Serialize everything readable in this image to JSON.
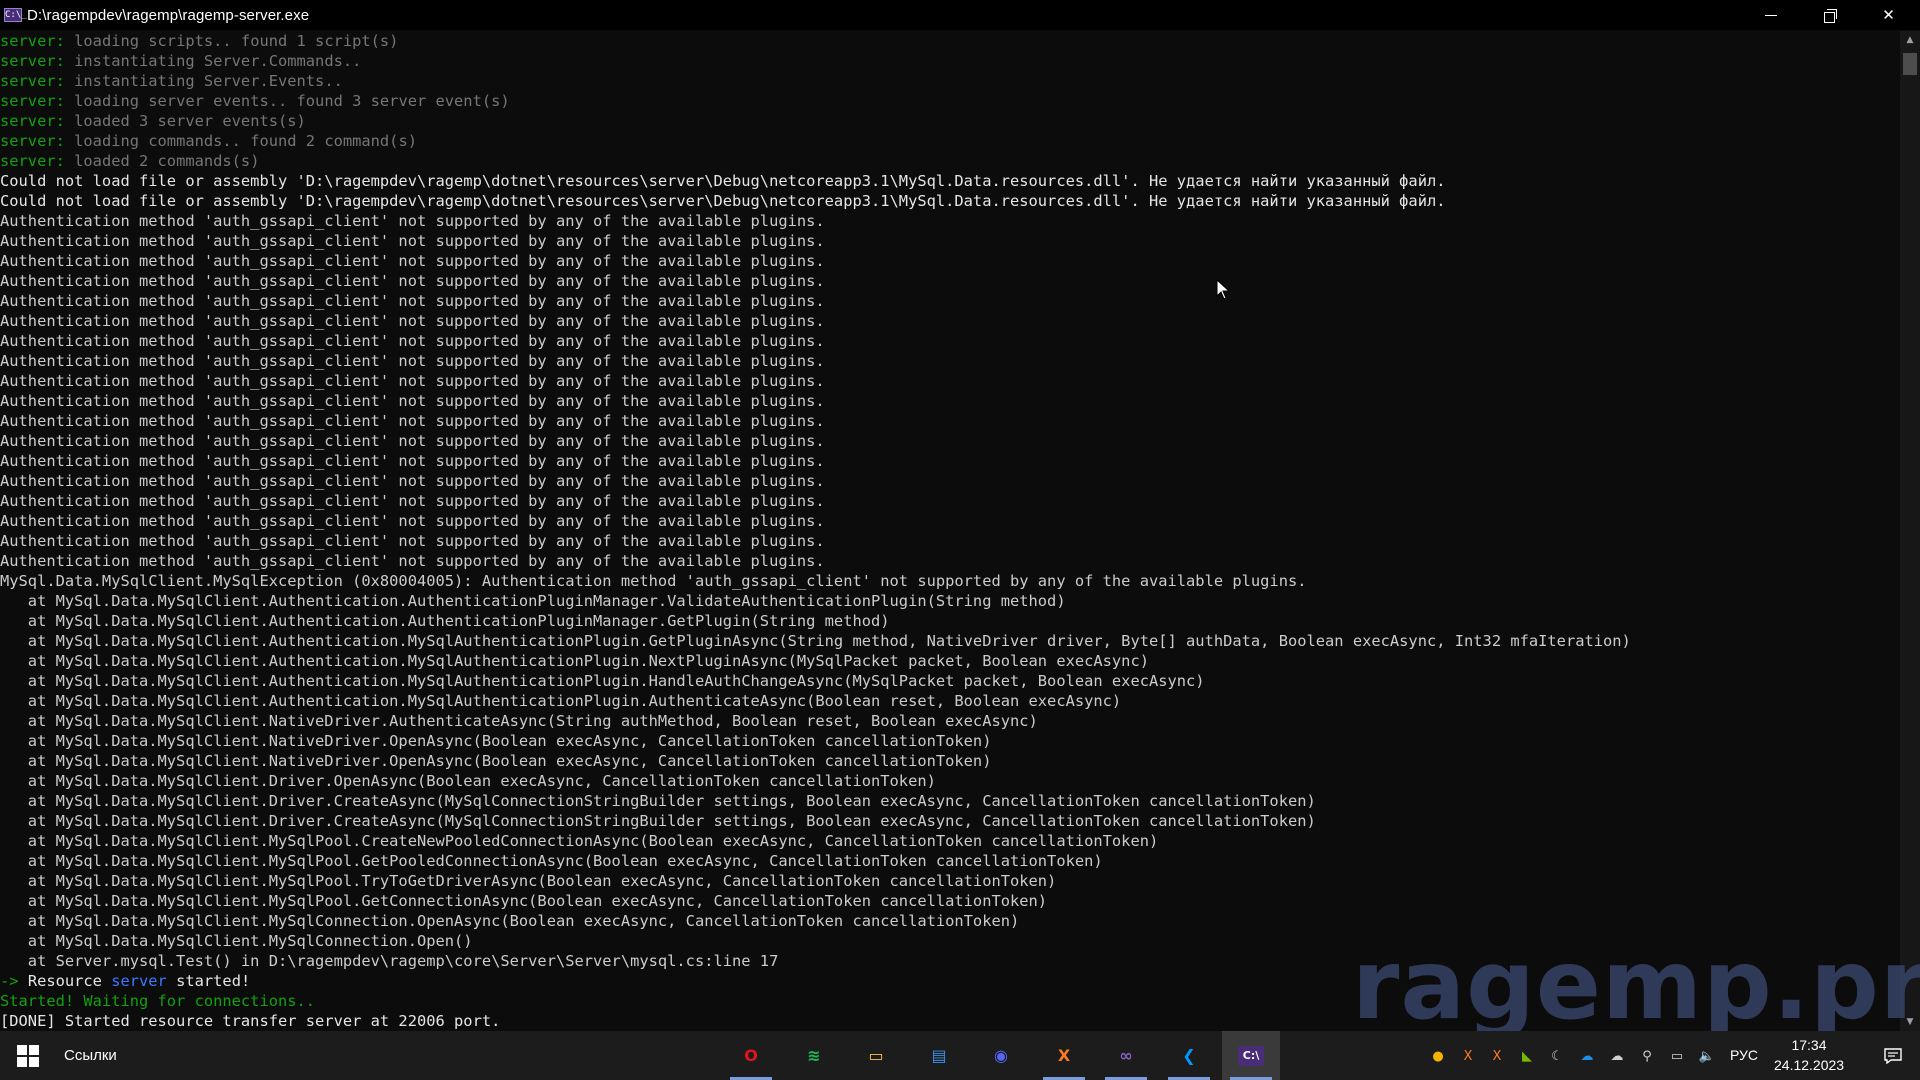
{
  "window": {
    "title": "D:\\ragempdev\\ragemp\\ragemp-server.exe",
    "app_icon_glyph": "C:\\_"
  },
  "colors": {
    "console_bg": "#0c0c0c",
    "default_text": "#cccccc",
    "prefix_green": "#13a10e",
    "dim_gray": "#767676",
    "accent_blue": "#3b78ff",
    "watermark": "#3a466e"
  },
  "console": {
    "lines": [
      {
        "prefix": "server:",
        "pc": "c-green",
        "text": " loading scripts.. found 1 script(s)",
        "tc": "c-gray"
      },
      {
        "prefix": "server:",
        "pc": "c-green",
        "text": " instantiating Server.Commands..",
        "tc": "c-gray"
      },
      {
        "prefix": "server:",
        "pc": "c-green",
        "text": " instantiating Server.Events..",
        "tc": "c-gray"
      },
      {
        "prefix": "server:",
        "pc": "c-green",
        "text": " loading server events.. found 3 server event(s)",
        "tc": "c-gray"
      },
      {
        "prefix": "server:",
        "pc": "c-green",
        "text": " loaded 3 server events(s)",
        "tc": "c-gray"
      },
      {
        "prefix": "server:",
        "pc": "c-green",
        "text": " loading commands.. found 2 command(s)",
        "tc": "c-gray"
      },
      {
        "prefix": "server:",
        "pc": "c-green",
        "text": " loaded 2 commands(s)",
        "tc": "c-gray"
      },
      {
        "text": "Could not load file or assembly 'D:\\ragempdev\\ragemp\\dotnet\\resources\\server\\Debug\\netcoreapp3.1\\MySql.Data.resources.dll'. Не удается найти указанный файл.",
        "tc": "c-white"
      },
      {
        "text": "Could not load file or assembly 'D:\\ragempdev\\ragemp\\dotnet\\resources\\server\\Debug\\netcoreapp3.1\\MySql.Data.resources.dll'. Не удается найти указанный файл.",
        "tc": "c-white"
      },
      {
        "text": "Authentication method 'auth_gssapi_client' not supported by any of the available plugins.",
        "tc": "c-light"
      },
      {
        "text": "Authentication method 'auth_gssapi_client' not supported by any of the available plugins.",
        "tc": "c-light"
      },
      {
        "text": "Authentication method 'auth_gssapi_client' not supported by any of the available plugins.",
        "tc": "c-light"
      },
      {
        "text": "Authentication method 'auth_gssapi_client' not supported by any of the available plugins.",
        "tc": "c-light"
      },
      {
        "text": "Authentication method 'auth_gssapi_client' not supported by any of the available plugins.",
        "tc": "c-light"
      },
      {
        "text": "Authentication method 'auth_gssapi_client' not supported by any of the available plugins.",
        "tc": "c-light"
      },
      {
        "text": "Authentication method 'auth_gssapi_client' not supported by any of the available plugins.",
        "tc": "c-light"
      },
      {
        "text": "Authentication method 'auth_gssapi_client' not supported by any of the available plugins.",
        "tc": "c-light"
      },
      {
        "text": "Authentication method 'auth_gssapi_client' not supported by any of the available plugins.",
        "tc": "c-light"
      },
      {
        "text": "Authentication method 'auth_gssapi_client' not supported by any of the available plugins.",
        "tc": "c-light"
      },
      {
        "text": "Authentication method 'auth_gssapi_client' not supported by any of the available plugins.",
        "tc": "c-light"
      },
      {
        "text": "Authentication method 'auth_gssapi_client' not supported by any of the available plugins.",
        "tc": "c-light"
      },
      {
        "text": "Authentication method 'auth_gssapi_client' not supported by any of the available plugins.",
        "tc": "c-light"
      },
      {
        "text": "Authentication method 'auth_gssapi_client' not supported by any of the available plugins.",
        "tc": "c-light"
      },
      {
        "text": "Authentication method 'auth_gssapi_client' not supported by any of the available plugins.",
        "tc": "c-light"
      },
      {
        "text": "Authentication method 'auth_gssapi_client' not supported by any of the available plugins.",
        "tc": "c-light"
      },
      {
        "text": "Authentication method 'auth_gssapi_client' not supported by any of the available plugins.",
        "tc": "c-light"
      },
      {
        "text": "Authentication method 'auth_gssapi_client' not supported by any of the available plugins.",
        "tc": "c-light"
      },
      {
        "text": "MySql.Data.MySqlClient.MySqlException (0x80004005): Authentication method 'auth_gssapi_client' not supported by any of the available plugins.",
        "tc": "c-light"
      },
      {
        "text": "   at MySql.Data.MySqlClient.Authentication.AuthenticationPluginManager.ValidateAuthenticationPlugin(String method)",
        "tc": "c-light"
      },
      {
        "text": "   at MySql.Data.MySqlClient.Authentication.AuthenticationPluginManager.GetPlugin(String method)",
        "tc": "c-light"
      },
      {
        "text": "   at MySql.Data.MySqlClient.Authentication.MySqlAuthenticationPlugin.GetPluginAsync(String method, NativeDriver driver, Byte[] authData, Boolean execAsync, Int32 mfaIteration)",
        "tc": "c-light"
      },
      {
        "text": "   at MySql.Data.MySqlClient.Authentication.MySqlAuthenticationPlugin.NextPluginAsync(MySqlPacket packet, Boolean execAsync)",
        "tc": "c-light"
      },
      {
        "text": "   at MySql.Data.MySqlClient.Authentication.MySqlAuthenticationPlugin.HandleAuthChangeAsync(MySqlPacket packet, Boolean execAsync)",
        "tc": "c-light"
      },
      {
        "text": "   at MySql.Data.MySqlClient.Authentication.MySqlAuthenticationPlugin.AuthenticateAsync(Boolean reset, Boolean execAsync)",
        "tc": "c-light"
      },
      {
        "text": "   at MySql.Data.MySqlClient.NativeDriver.AuthenticateAsync(String authMethod, Boolean reset, Boolean execAsync)",
        "tc": "c-light"
      },
      {
        "text": "   at MySql.Data.MySqlClient.NativeDriver.OpenAsync(Boolean execAsync, CancellationToken cancellationToken)",
        "tc": "c-light"
      },
      {
        "text": "   at MySql.Data.MySqlClient.NativeDriver.OpenAsync(Boolean execAsync, CancellationToken cancellationToken)",
        "tc": "c-light"
      },
      {
        "text": "   at MySql.Data.MySqlClient.Driver.OpenAsync(Boolean execAsync, CancellationToken cancellationToken)",
        "tc": "c-light"
      },
      {
        "text": "   at MySql.Data.MySqlClient.Driver.CreateAsync(MySqlConnectionStringBuilder settings, Boolean execAsync, CancellationToken cancellationToken)",
        "tc": "c-light"
      },
      {
        "text": "   at MySql.Data.MySqlClient.Driver.CreateAsync(MySqlConnectionStringBuilder settings, Boolean execAsync, CancellationToken cancellationToken)",
        "tc": "c-light"
      },
      {
        "text": "   at MySql.Data.MySqlClient.MySqlPool.CreateNewPooledConnectionAsync(Boolean execAsync, CancellationToken cancellationToken)",
        "tc": "c-light"
      },
      {
        "text": "   at MySql.Data.MySqlClient.MySqlPool.GetPooledConnectionAsync(Boolean execAsync, CancellationToken cancellationToken)",
        "tc": "c-light"
      },
      {
        "text": "   at MySql.Data.MySqlClient.MySqlPool.TryToGetDriverAsync(Boolean execAsync, CancellationToken cancellationToken)",
        "tc": "c-light"
      },
      {
        "text": "   at MySql.Data.MySqlClient.MySqlPool.GetConnectionAsync(Boolean execAsync, CancellationToken cancellationToken)",
        "tc": "c-light"
      },
      {
        "text": "   at MySql.Data.MySqlClient.MySqlConnection.OpenAsync(Boolean execAsync, CancellationToken cancellationToken)",
        "tc": "c-light"
      },
      {
        "text": "   at MySql.Data.MySqlClient.MySqlConnection.Open()",
        "tc": "c-light"
      },
      {
        "text": "   at Server.mysql.Test() in D:\\ragempdev\\ragemp\\core\\Server\\Server\\mysql.cs:line 17",
        "tc": "c-light"
      },
      {
        "prefix": "->",
        "pc": "c-green",
        "text": " Resource ",
        "tc": "c-white",
        "hl": "server",
        "hc": "c-blue",
        "tail": " started!",
        "tailc": "c-white"
      },
      {
        "text": "Started! Waiting for connections..",
        "tc": "c-green"
      },
      {
        "text": "[DONE] Started resource transfer server at 22006 port.",
        "tc": "c-white"
      }
    ]
  },
  "watermark": {
    "text": "ragemp.pro"
  },
  "taskbar": {
    "search_label": "Ссылки",
    "apps": [
      {
        "name": "opera-icon",
        "glyph": "O",
        "color": "#e0161b",
        "running": true
      },
      {
        "name": "spotify-icon",
        "glyph": "≋",
        "color": "#1db954",
        "running": false
      },
      {
        "name": "file-explorer-icon",
        "glyph": "▭",
        "color": "#f2c14e",
        "running": false
      },
      {
        "name": "control-panel-icon",
        "glyph": "▤",
        "color": "#3a8ee6",
        "running": false
      },
      {
        "name": "discord-icon",
        "glyph": "◉",
        "color": "#5865f2",
        "running": false
      },
      {
        "name": "xampp-icon",
        "glyph": "X",
        "color": "#fb7a24",
        "running": true
      },
      {
        "name": "visual-studio-icon",
        "glyph": "∞",
        "color": "#8661c5",
        "running": true
      },
      {
        "name": "vscode-icon",
        "glyph": "❮",
        "color": "#0098ff",
        "running": true
      },
      {
        "name": "terminal-icon",
        "glyph": "C:\\",
        "color": "#4a2d78",
        "running": true,
        "active": true
      }
    ],
    "tray": [
      {
        "name": "chrome-tray-icon",
        "glyph": "●",
        "color": "#f4b400"
      },
      {
        "name": "xampp-tray-icon",
        "glyph": "X",
        "color": "#fb7a24"
      },
      {
        "name": "xampp-tray-icon-2",
        "glyph": "X",
        "color": "#fb7a24"
      },
      {
        "name": "nvidia-tray-icon",
        "glyph": "◣",
        "color": "#76b900"
      },
      {
        "name": "moon-tray-icon",
        "glyph": "☾",
        "color": "#d0d0d0"
      },
      {
        "name": "onedrive-tray-icon",
        "glyph": "☁",
        "color": "#1e8fe6"
      },
      {
        "name": "weather-tray-icon",
        "glyph": "☁",
        "color": "#d0d0d0"
      },
      {
        "name": "search-tray-icon",
        "glyph": "⚲",
        "color": "#d0d0d0"
      },
      {
        "name": "network-tray-icon",
        "glyph": "▭",
        "color": "#d0d0d0"
      },
      {
        "name": "volume-tray-icon",
        "glyph": "🔈",
        "color": "#d0d0d0"
      }
    ],
    "language": "РУС",
    "time": "17:34",
    "date": "24.12.2023"
  }
}
